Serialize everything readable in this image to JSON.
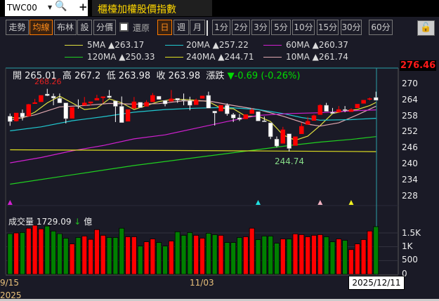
{
  "header": {
    "symbol": "TWC00",
    "title": "櫃檯加權股價指數"
  },
  "toolbar": {
    "buttons": [
      "走勢",
      "均線",
      "布林",
      "設",
      "分價"
    ],
    "active_button": "均線",
    "restore_label": "還原",
    "restore_checked": false,
    "periods": [
      "日",
      "週",
      "月"
    ],
    "active_period": "日",
    "minutes": [
      "1分",
      "2分",
      "3分",
      "5分",
      "10分",
      "15分",
      "30分",
      "60分"
    ]
  },
  "legend": [
    {
      "label": "5MA",
      "value": "▲263.17",
      "color": "#e0e040"
    },
    {
      "label": "20MA",
      "value": "▲257.22",
      "color": "#20c8d0"
    },
    {
      "label": "60MA",
      "value": "▲260.37",
      "color": "#d020d0"
    },
    {
      "label": "120MA",
      "value": "▲250.33",
      "color": "#20d020"
    },
    {
      "label": "240MA",
      "value": "▲244.71",
      "color": "#e0e020"
    },
    {
      "label": "10MA",
      "value": "▲261.74",
      "color": "#e0a8b0"
    }
  ],
  "ohlc": {
    "open_label": "開",
    "open": "265.01",
    "high_label": "高",
    "high": "267.2",
    "low_label": "低",
    "low": "263.98",
    "close_label": "收",
    "close": "263.98",
    "change_label": "漲跌",
    "change": "▼-0.69 (-0.26%)"
  },
  "volume": {
    "label": "成交量",
    "value": "1729.09",
    "arrow": "↓",
    "unit": "億"
  },
  "chart_data": [
    {
      "type": "candlestick",
      "up_color": "#ff0000",
      "down_color": "#ffffff",
      "y_ticks": [
        "270",
        "264",
        "258",
        "252",
        "246",
        "240",
        "234",
        "228"
      ],
      "ylim": [
        226,
        276.46
      ],
      "current_axis_label": "276.46",
      "period_high_label": "268.26",
      "period_low_label": "244.74",
      "x_tick_labels": [
        {
          "index": 0,
          "label": "9/15",
          "year": "2025"
        },
        {
          "index": 30,
          "label": "11/03"
        }
      ],
      "cursor_label": "2025/12/11",
      "ohlc": [
        [
          258.0,
          259.0,
          254.4,
          256.0
        ],
        [
          256.2,
          259.2,
          256.0,
          259.2
        ],
        [
          259.2,
          260.5,
          256.4,
          257.7
        ],
        [
          258.0,
          262.6,
          258.0,
          262.4
        ],
        [
          262.7,
          264.5,
          262.7,
          263.1
        ],
        [
          263.4,
          265.8,
          263.4,
          265.8
        ],
        [
          266.3,
          268.26,
          265.5,
          265.7
        ],
        [
          265.5,
          266.5,
          262.1,
          264.8
        ],
        [
          264.7,
          266.5,
          263.0,
          263.0
        ],
        [
          263.0,
          263.0,
          255.3,
          257.1
        ],
        [
          257.2,
          261.3,
          257.2,
          261.3
        ],
        [
          261.9,
          264.3,
          260.8,
          261.7
        ],
        [
          262.1,
          265.2,
          262.1,
          263.0
        ],
        [
          262.9,
          263.4,
          262.0,
          263.4
        ],
        [
          264.0,
          266.0,
          264.0,
          264.7
        ],
        [
          264.9,
          265.3,
          263.0,
          265.3
        ],
        [
          265.6,
          267.8,
          264.8,
          265.0
        ],
        [
          263.7,
          263.7,
          255.8,
          261.7
        ],
        [
          261.7,
          265.4,
          255.6,
          255.6
        ],
        [
          256.1,
          260.5,
          256.1,
          260.5
        ],
        [
          261.0,
          265.2,
          261.0,
          263.4
        ],
        [
          263.2,
          263.2,
          261.2,
          261.2
        ],
        [
          261.7,
          264.0,
          261.7,
          263.2
        ],
        [
          263.4,
          266.7,
          263.4,
          265.8
        ],
        [
          265.5,
          265.5,
          264.3,
          264.3
        ],
        [
          263.9,
          263.9,
          261.7,
          262.6
        ],
        [
          263.6,
          267.8,
          263.6,
          264.5
        ],
        [
          264.7,
          264.7,
          263.0,
          264.0
        ],
        [
          264.1,
          266.5,
          262.1,
          263.8
        ],
        [
          263.9,
          265.3,
          260.2,
          262.1
        ],
        [
          262.3,
          264.6,
          262.3,
          264.0
        ],
        [
          264.7,
          265.6,
          264.7,
          265.6
        ],
        [
          265.8,
          267.2,
          261.0,
          261.0
        ],
        [
          259.9,
          259.9,
          254.5,
          259.2
        ],
        [
          259.9,
          262.1,
          259.9,
          262.1
        ],
        [
          262.1,
          262.8,
          258.2,
          258.9
        ],
        [
          258.6,
          259.2,
          255.8,
          257.3
        ],
        [
          257.4,
          258.8,
          256.2,
          256.8
        ],
        [
          257.0,
          258.6,
          257.0,
          258.6
        ],
        [
          259.0,
          261.0,
          259.0,
          260.4
        ],
        [
          259.7,
          259.7,
          256.2,
          256.2
        ],
        [
          256.3,
          257.9,
          255.9,
          255.9
        ],
        [
          255.5,
          255.5,
          249.4,
          250.3
        ],
        [
          249.4,
          250.4,
          246.3,
          246.8
        ],
        [
          247.8,
          254.0,
          247.8,
          252.9
        ],
        [
          251.4,
          251.4,
          244.74,
          245.9
        ],
        [
          247.0,
          250.3,
          247.0,
          250.3
        ],
        [
          251.4,
          255.5,
          251.4,
          254.2
        ],
        [
          254.9,
          257.7,
          254.9,
          256.1
        ],
        [
          256.4,
          258.6,
          256.4,
          258.2
        ],
        [
          258.6,
          262.5,
          258.6,
          262.1
        ],
        [
          262.1,
          263.0,
          259.8,
          259.8
        ],
        [
          259.5,
          261.1,
          259.0,
          259.0
        ],
        [
          259.5,
          261.8,
          259.5,
          260.5
        ],
        [
          260.5,
          261.8,
          259.5,
          260.1
        ],
        [
          259.7,
          261.0,
          259.7,
          260.5
        ],
        [
          261.1,
          262.5,
          261.1,
          262.5
        ],
        [
          262.8,
          264.0,
          262.8,
          264.0
        ],
        [
          264.3,
          265.0,
          263.9,
          264.6
        ],
        [
          265.01,
          267.2,
          263.98,
          263.98
        ]
      ],
      "moving_averages": [
        {
          "name": "5MA",
          "color": "#e0e040",
          "points": [
            [
              0,
              257.5
            ],
            [
              2,
              257.3
            ],
            [
              4,
              259.5
            ],
            [
              6,
              263
            ],
            [
              8,
              265.5
            ],
            [
              10,
              263
            ],
            [
              12,
              260.5
            ],
            [
              14,
              261
            ],
            [
              16,
              264.5
            ],
            [
              18,
              263
            ],
            [
              20,
              260.5
            ],
            [
              22,
              262
            ],
            [
              24,
              263.5
            ],
            [
              26,
              264.2
            ],
            [
              28,
              264.3
            ],
            [
              30,
              264
            ],
            [
              32,
              263.5
            ],
            [
              34,
              261
            ],
            [
              36,
              260.8
            ],
            [
              38,
              258
            ],
            [
              40,
              258
            ],
            [
              42,
              256
            ],
            [
              44,
              251
            ],
            [
              46,
              249
            ],
            [
              48,
              250.5
            ],
            [
              50,
              254.5
            ],
            [
              52,
              259
            ],
            [
              54,
              260
            ],
            [
              56,
              260.5
            ],
            [
              58,
              262
            ],
            [
              59,
              263.17
            ]
          ]
        },
        {
          "name": "10MA",
          "color": "#e0a8b0",
          "points": [
            [
              0,
              256.5
            ],
            [
              4,
              258.5
            ],
            [
              8,
              261.5
            ],
            [
              12,
              262
            ],
            [
              16,
              262.8
            ],
            [
              20,
              262.5
            ],
            [
              24,
              262.7
            ],
            [
              28,
              263.8
            ],
            [
              32,
              263.7
            ],
            [
              36,
              262
            ],
            [
              40,
              260.5
            ],
            [
              44,
              258
            ],
            [
              48,
              255
            ],
            [
              50,
              254.3
            ],
            [
              53,
              255.5
            ],
            [
              56,
              258.5
            ],
            [
              59,
              261.74
            ]
          ]
        },
        {
          "name": "20MA",
          "color": "#20c8d0",
          "points": [
            [
              0,
              252.5
            ],
            [
              5,
              254
            ],
            [
              10,
              256.3
            ],
            [
              15,
              257.8
            ],
            [
              20,
              259.5
            ],
            [
              25,
              260.5
            ],
            [
              30,
              261
            ],
            [
              35,
              261.3
            ],
            [
              40,
              260.5
            ],
            [
              44,
              259
            ],
            [
              47,
              257.5
            ],
            [
              50,
              256.5
            ],
            [
              55,
              256.7
            ],
            [
              59,
              257.22
            ]
          ]
        },
        {
          "name": "60MA",
          "color": "#d020d0",
          "points": [
            [
              0,
              240.5
            ],
            [
              5,
              242.5
            ],
            [
              10,
              245
            ],
            [
              15,
              247
            ],
            [
              20,
              249.5
            ],
            [
              25,
              251
            ],
            [
              30,
              253.5
            ],
            [
              35,
              256
            ],
            [
              40,
              258.3
            ],
            [
              45,
              259
            ],
            [
              50,
              259.3
            ],
            [
              55,
              260
            ],
            [
              59,
              260.37
            ]
          ]
        },
        {
          "name": "120MA",
          "color": "#20d020",
          "points": [
            [
              0,
              232.5
            ],
            [
              10,
              236
            ],
            [
              20,
              239.5
            ],
            [
              30,
              242.5
            ],
            [
              40,
              245.5
            ],
            [
              45,
              247
            ],
            [
              50,
              248.3
            ],
            [
              55,
              249.3
            ],
            [
              59,
              250.33
            ]
          ]
        },
        {
          "name": "240MA",
          "color": "#e0e020",
          "points": [
            [
              0,
              245.4
            ],
            [
              30,
              245.1
            ],
            [
              59,
              244.71
            ]
          ]
        }
      ],
      "signal_markers": [
        {
          "index": 0,
          "color": "#d020d0"
        },
        {
          "index": 40,
          "color": "#20e0e0"
        },
        {
          "index": 50,
          "color": "#f0b0c0"
        },
        {
          "index": 55,
          "color": "#f0f020"
        }
      ]
    },
    {
      "type": "bar",
      "y_ticks": [
        "1.5K",
        "1K",
        "500",
        "0"
      ],
      "ylim": [
        0,
        1900
      ],
      "up_color": "#ff0000",
      "down_color": "#008000",
      "values": [
        1474,
        1500,
        1517,
        1672,
        1776,
        1647,
        1750,
        1569,
        1474,
        1310,
        1103,
        1336,
        1388,
        1267,
        1621,
        1414,
        1336,
        1336,
        1672,
        1362,
        1362,
        1026,
        1181,
        1284,
        1155,
        1026,
        1207,
        1543,
        1414,
        1517,
        1414,
        1310,
        1491,
        1440,
        1414,
        1155,
        1155,
        1336,
        1362,
        1672,
        1259,
        1388,
        1388,
        1129,
        1284,
        1284,
        1466,
        1440,
        1362,
        1414,
        1440,
        1362,
        1181,
        1284,
        1233,
        897,
        1103,
        1259,
        1569,
        1729
      ]
    }
  ]
}
